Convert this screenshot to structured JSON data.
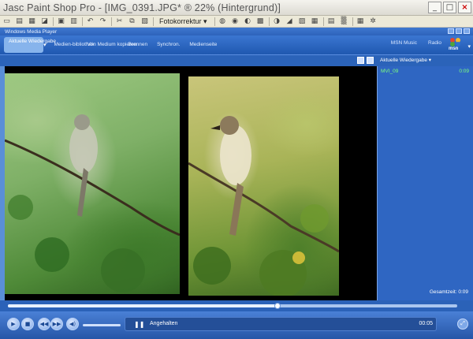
{
  "app": {
    "title": "Jasc Paint Shop Pro - [IMG_0391.JPG* ® 22% (Hintergrund)]",
    "window_buttons": [
      "_",
      "□",
      "×"
    ]
  },
  "psp_toolbar": {
    "dropdown_label": "Fotokorrektur ▾"
  },
  "wmp": {
    "window_title": "Windows Media Player",
    "tabs": [
      {
        "label": "Aktuelle Wiedergabe",
        "active": true
      },
      {
        "label": "Medien-bibliothek",
        "active": false
      },
      {
        "label": "Von Medium kopieren",
        "active": false
      },
      {
        "label": "Brennen",
        "active": false
      },
      {
        "label": "Synchron.",
        "active": false
      },
      {
        "label": "Medienseite",
        "active": false
      }
    ],
    "right_links": [
      "MSN Music",
      "Radio"
    ],
    "msn_label": "msn",
    "playlist_title": "Aktuelle Wiedergabe ▾",
    "playlist_items": [
      {
        "name": "MVI_09",
        "duration": "0:09"
      }
    ],
    "total_time": "Gesamtzeit: 0:09",
    "status": "Angehalten",
    "current_time": "00:05",
    "seek_progress": 0.6,
    "colors": {
      "accent": "#2b63b9",
      "playlist_text": "#7dff7d"
    }
  }
}
